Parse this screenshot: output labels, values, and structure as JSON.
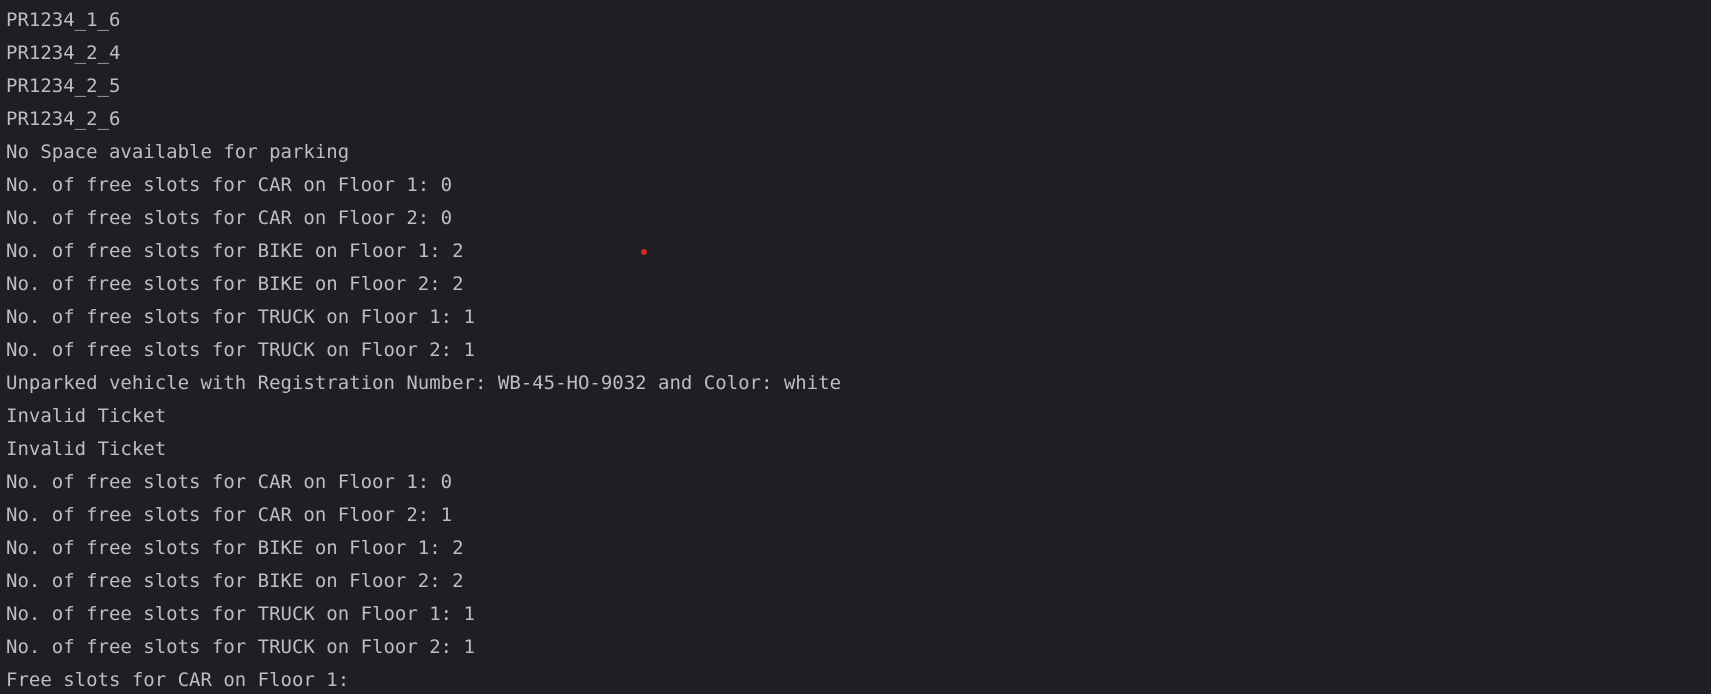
{
  "console": {
    "lines": [
      "PR1234_1_6",
      "PR1234_2_4",
      "PR1234_2_5",
      "PR1234_2_6",
      "No Space available for parking",
      "No. of free slots for CAR on Floor 1: 0",
      "No. of free slots for CAR on Floor 2: 0",
      "No. of free slots for BIKE on Floor 1: 2",
      "No. of free slots for BIKE on Floor 2: 2",
      "No. of free slots for TRUCK on Floor 1: 1",
      "No. of free slots for TRUCK on Floor 2: 1",
      "Unparked vehicle with Registration Number: WB-45-HO-9032 and Color: white",
      "Invalid Ticket",
      "Invalid Ticket",
      "No. of free slots for CAR on Floor 1: 0",
      "No. of free slots for CAR on Floor 2: 1",
      "No. of free slots for BIKE on Floor 1: 2",
      "No. of free slots for BIKE on Floor 2: 2",
      "No. of free slots for TRUCK on Floor 1: 1",
      "No. of free slots for TRUCK on Floor 2: 1",
      "Free slots for CAR on Floor 1:"
    ]
  },
  "colors": {
    "background": "#1e1f22",
    "text": "#bcbec4",
    "marker": "#d22c2c"
  }
}
